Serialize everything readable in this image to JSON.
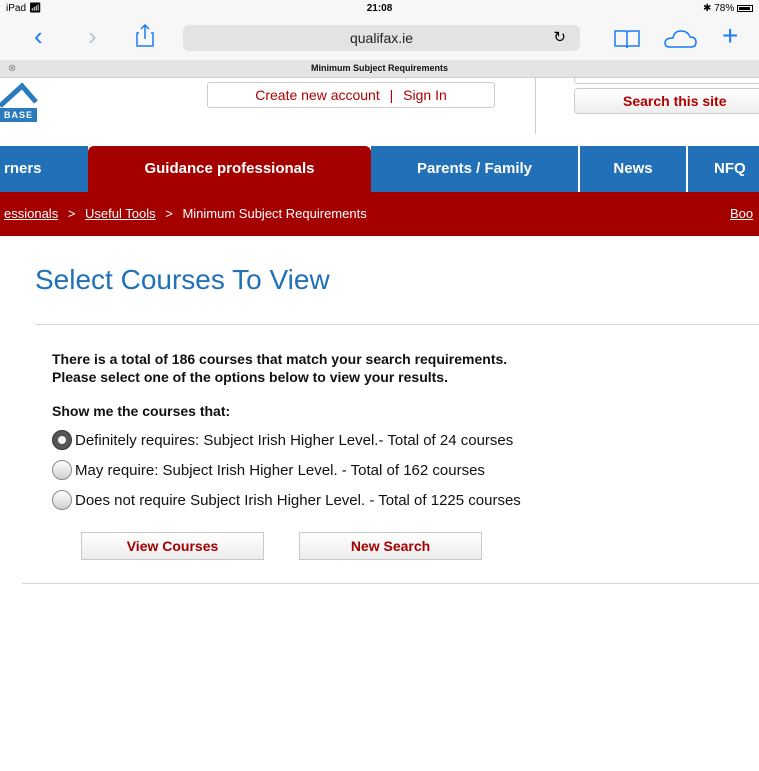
{
  "status_bar": {
    "device": "iPad",
    "wifi_icon": "wifi-icon",
    "time": "21:08",
    "bluetooth_icon": "bluetooth-icon",
    "battery": "78%"
  },
  "browser": {
    "url": "qualifax.ie",
    "tab_title": "Minimum Subject Requirements",
    "icons": [
      "back-icon",
      "forward-icon",
      "share-icon",
      "reload-icon",
      "bookmarks-icon",
      "cloud-tabs-icon",
      "new-tab-icon",
      "close-tab-icon"
    ]
  },
  "header": {
    "logo_text": "BASE",
    "create_account": "Create new account",
    "separator": "|",
    "sign_in": "Sign In",
    "search_site": "Search this site"
  },
  "nav": {
    "tabs": [
      {
        "label": "rners"
      },
      {
        "label": "Guidance professionals"
      },
      {
        "label": "Parents / Family"
      },
      {
        "label": "News"
      },
      {
        "label": "NFQ"
      }
    ]
  },
  "breadcrumb": {
    "items": [
      "essionals",
      "Useful Tools",
      "Minimum Subject Requirements"
    ],
    "separator": ">",
    "right_link": "Boo"
  },
  "content": {
    "title": "Select Courses To View",
    "intro_line1": "There is a total of 186 courses that match your search requirements.",
    "intro_line2": "Please select one of the options below to view your results.",
    "show_label": "Show me the courses that:",
    "options": [
      {
        "label": "Definitely requires: Subject Irish Higher Level.- Total of 24 courses",
        "checked": true
      },
      {
        "label": "May require: Subject Irish Higher Level. - Total of 162 courses",
        "checked": false
      },
      {
        "label": "Does not require Subject Irish Higher Level. - Total of 1225 courses",
        "checked": false
      }
    ],
    "view_button": "View Courses",
    "new_search_button": "New Search"
  },
  "colors": {
    "accent_red": "#a50000",
    "accent_blue": "#2170b8",
    "ios_blue": "#1a7cf5"
  }
}
